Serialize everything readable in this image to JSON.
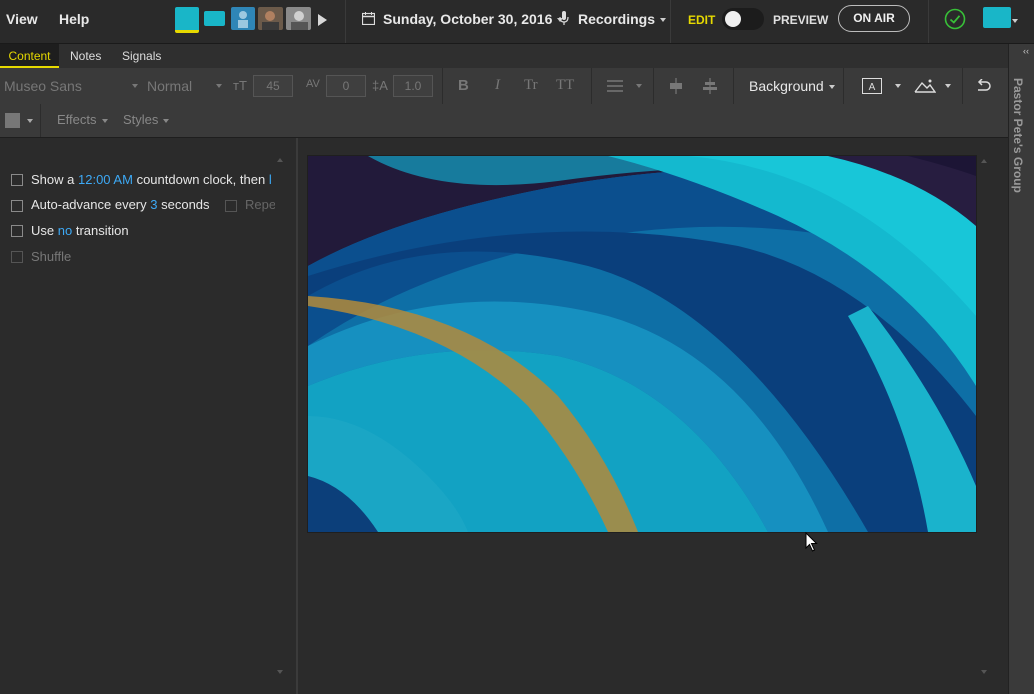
{
  "menu": {
    "view": "View",
    "help": "Help"
  },
  "header": {
    "date": "Sunday, October 30, 2016",
    "recordings": "Recordings",
    "edit": "EDIT",
    "preview": "PREVIEW",
    "on_air": "ON AIR",
    "accent_yellow": "#e6d900",
    "accent_teal": "#19b6c8"
  },
  "tabs": {
    "content": "Content",
    "notes": "Notes",
    "signals": "Signals"
  },
  "toolbar": {
    "font": "Museo Sans",
    "weight": "Normal",
    "size": "45",
    "tracking": "0",
    "line_height": "1.0",
    "bold": "B",
    "italic": "I",
    "title_case": "Tr",
    "upper_case": "TT",
    "background": "Background",
    "effects": "Effects",
    "styles": "Styles"
  },
  "options": {
    "row1_prefix": "Show a",
    "row1_time": "12:00 AM",
    "row1_suffix": "countdown clock, then",
    "row1_trail": "l",
    "row2_prefix": "Auto-advance every",
    "row2_num": "3",
    "row2_suffix": "seconds",
    "row2_repeat": "Repe",
    "row3_prefix": "Use",
    "row3_value": "no",
    "row3_suffix": "transition",
    "row4": "Shuffle"
  },
  "sidebar": {
    "group": "Pastor Pete's Group"
  }
}
